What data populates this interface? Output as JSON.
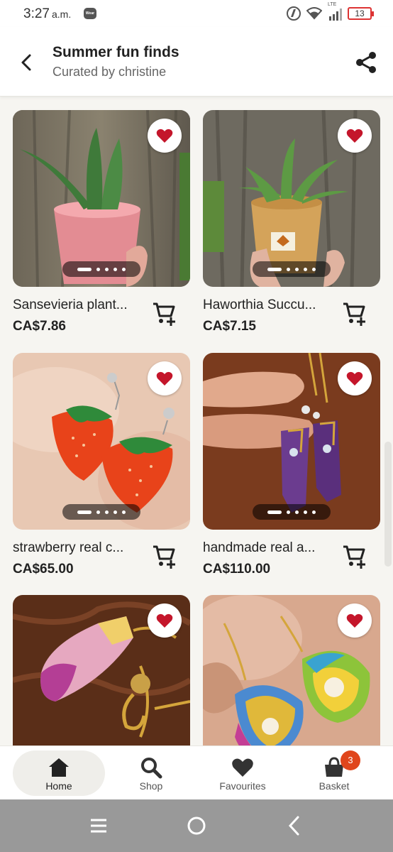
{
  "status_bar": {
    "time": "3:27",
    "ampm": "a.m.",
    "wear_label": "Wear",
    "network": "LTE",
    "battery": "13"
  },
  "header": {
    "title": "Summer fun finds",
    "subtitle": "Curated by christine"
  },
  "products": [
    {
      "name": "Sansevieria plant...",
      "price": "CA$7.86",
      "dots": 5,
      "active_dot": 0
    },
    {
      "name": "Haworthia Succu...",
      "price": "CA$7.15",
      "dots": 5,
      "active_dot": 0
    },
    {
      "name": "strawberry real c...",
      "price": "CA$65.00",
      "dots": 5,
      "active_dot": 0
    },
    {
      "name": "handmade real a...",
      "price": "CA$110.00",
      "dots": 5,
      "active_dot": 0
    },
    {
      "name": "",
      "price": ""
    },
    {
      "name": "",
      "price": ""
    }
  ],
  "bottom_nav": {
    "items": [
      {
        "label": "Home",
        "icon": "home-icon",
        "active": true
      },
      {
        "label": "Shop",
        "icon": "search-icon",
        "active": false
      },
      {
        "label": "Favourites",
        "icon": "heart-icon",
        "active": false
      },
      {
        "label": "Basket",
        "icon": "basket-icon",
        "active": false,
        "badge": "3"
      }
    ]
  },
  "colors": {
    "favourite": "#c4162b",
    "badge": "#e0461c",
    "active_nav_bg": "#efeeea"
  }
}
